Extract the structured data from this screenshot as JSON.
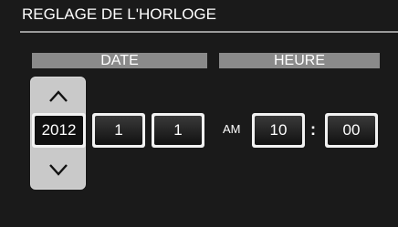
{
  "header": {
    "title": "REGLAGE DE L'HORLOGE"
  },
  "sections": {
    "date_label": "DATE",
    "time_label": "HEURE"
  },
  "date": {
    "year": "2012",
    "month": "1",
    "day": "1"
  },
  "time": {
    "period": "AM",
    "hour": "10",
    "separator": ":",
    "minute": "00"
  },
  "icons": {
    "up": "chevron-up-icon",
    "down": "chevron-down-icon"
  },
  "colors": {
    "background": "#1a1a1a",
    "section_bar": "#8a8a8a",
    "spinner": "#c9c9c9",
    "field_border": "#f2f2f2"
  }
}
